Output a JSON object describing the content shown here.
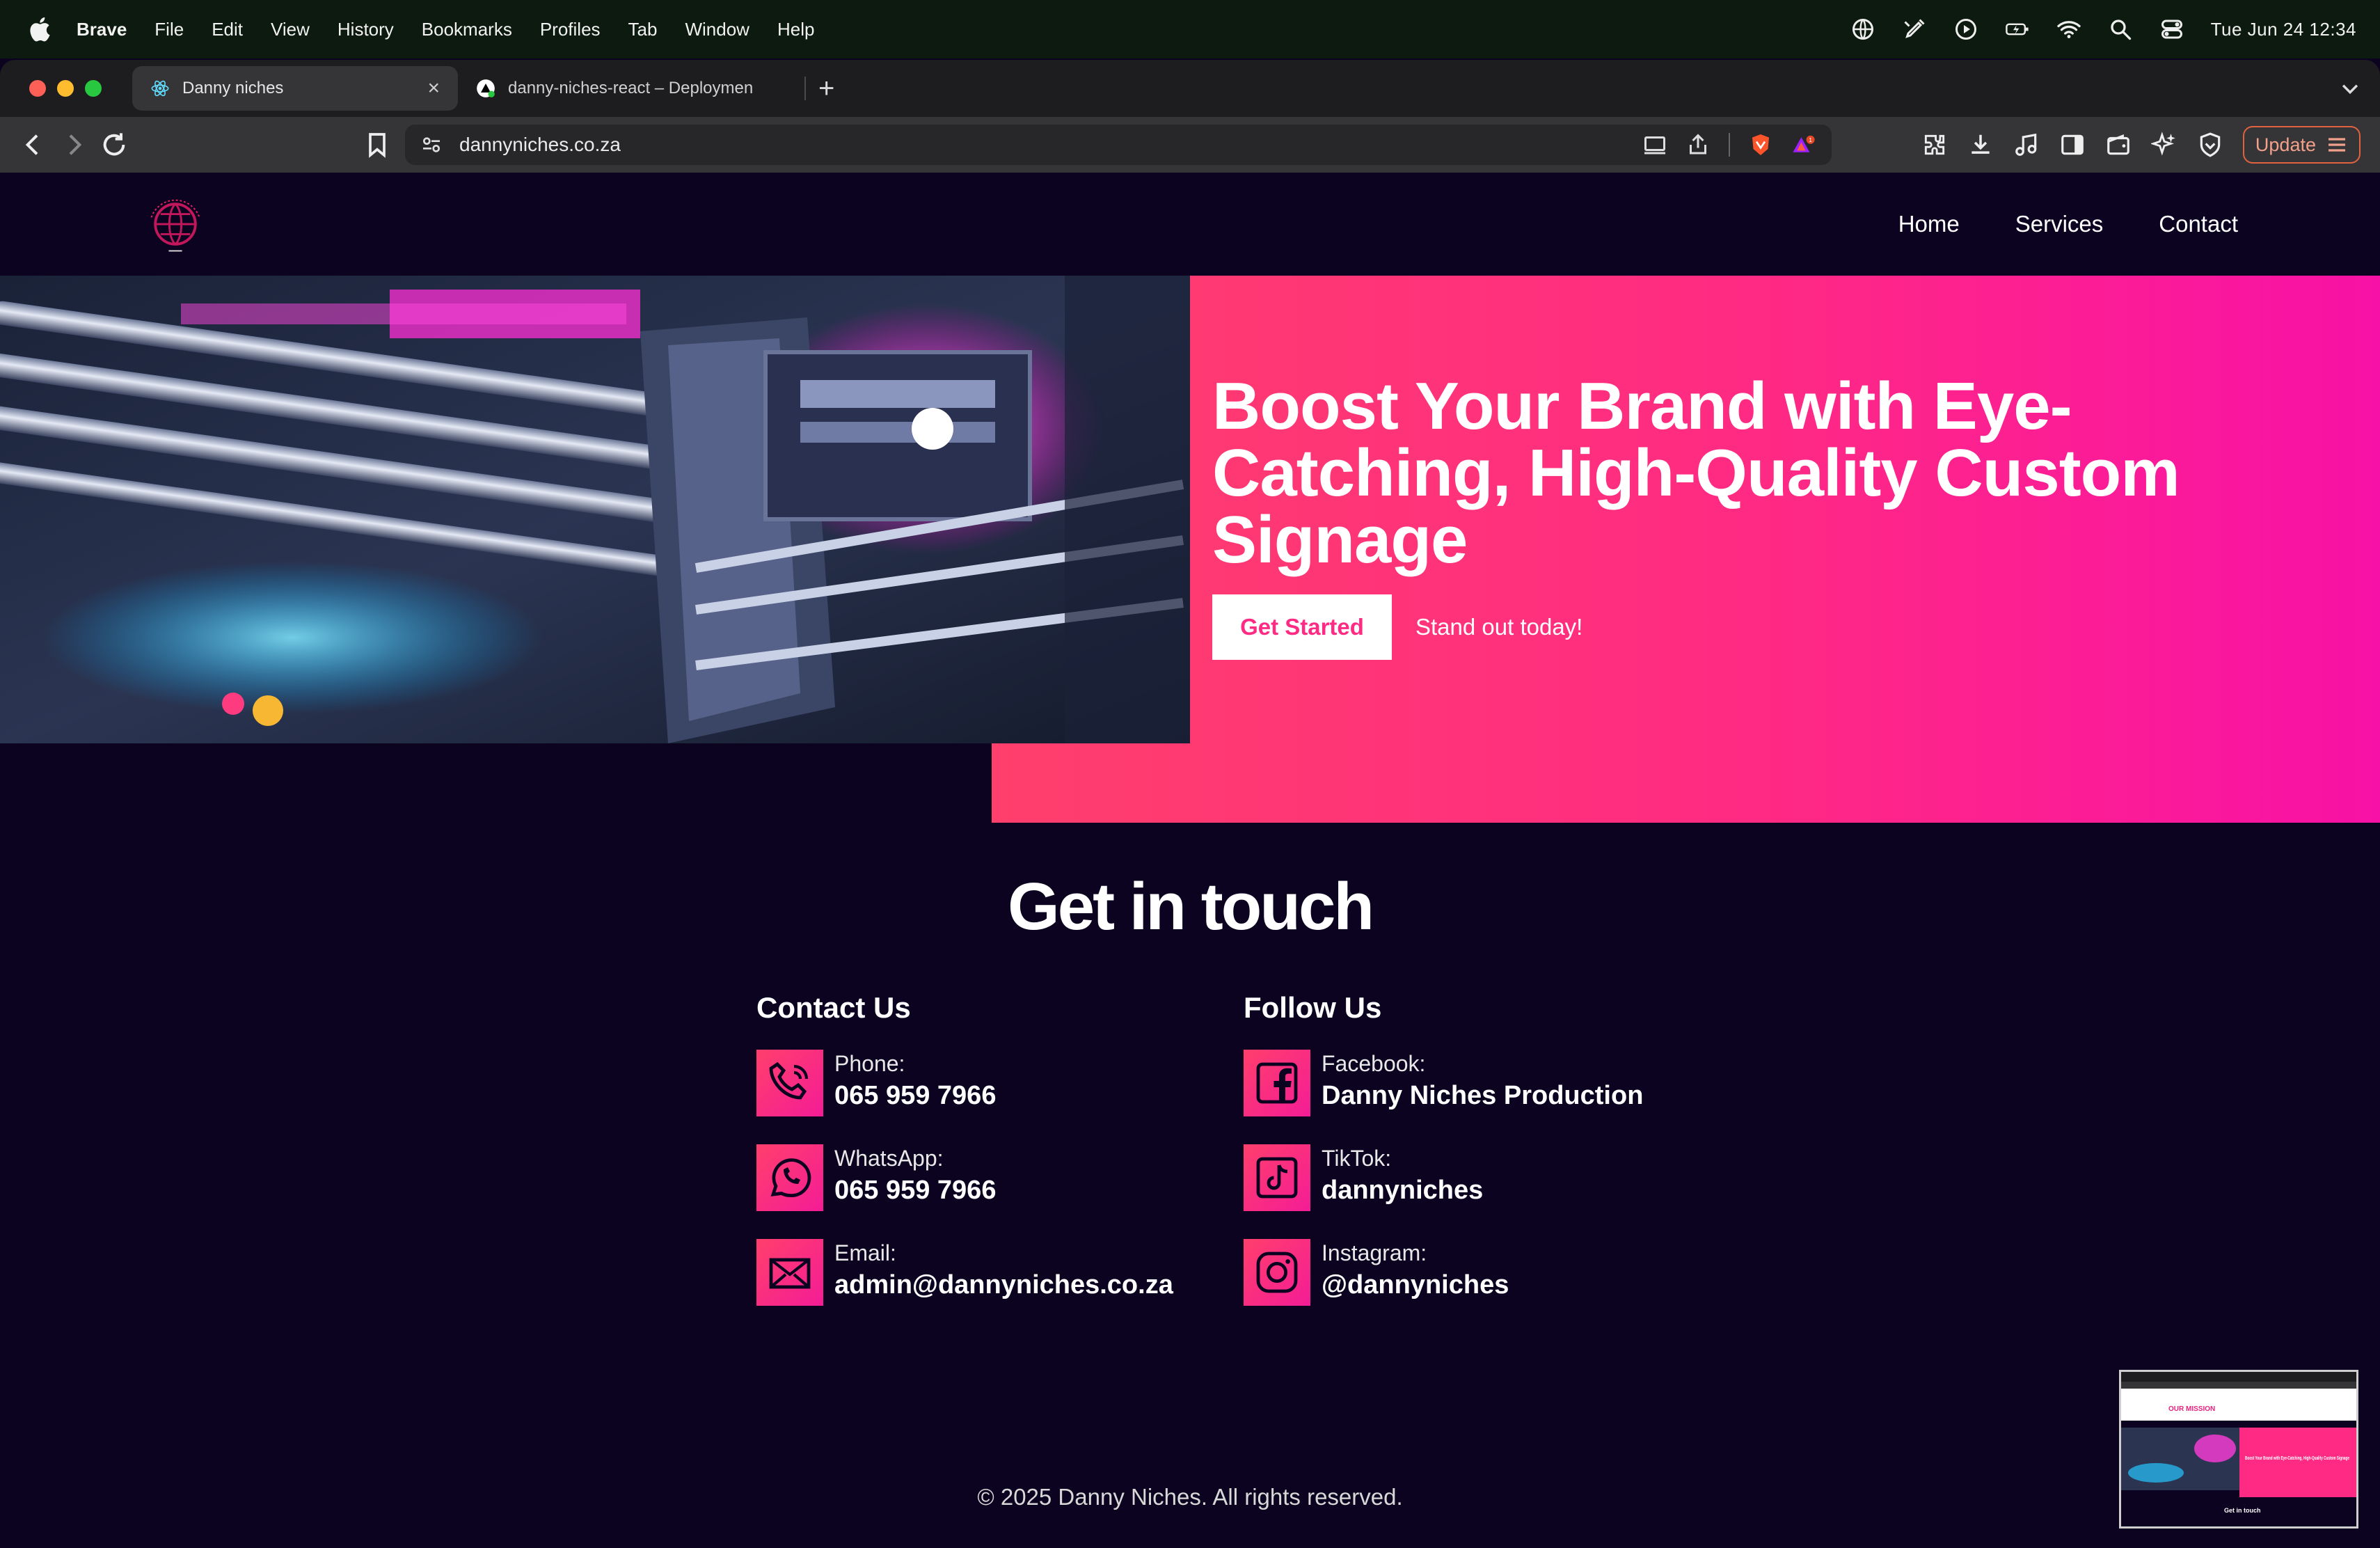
{
  "menubar": {
    "app_name": "Brave",
    "items": [
      "File",
      "Edit",
      "View",
      "History",
      "Bookmarks",
      "Profiles",
      "Tab",
      "Window",
      "Help"
    ],
    "clock": "Tue Jun 24  12:34"
  },
  "browser": {
    "tabs": [
      {
        "title": "Danny niches",
        "active": true
      },
      {
        "title": "danny-niches-react – Deploymen",
        "active": false
      }
    ],
    "new_tab": "+",
    "url": "dannyniches.co.za",
    "update_label": "Update",
    "shield_badge": "1"
  },
  "site": {
    "nav": [
      "Home",
      "Services",
      "Contact"
    ],
    "hero": {
      "title": "Boost Your Brand with Eye-Catching, High-Quality Custom Signage",
      "cta": "Get Started",
      "tagline": "Stand out today!"
    },
    "contact": {
      "title": "Get in touch",
      "contact_us": {
        "heading": "Contact Us",
        "entries": [
          {
            "label": "Phone:",
            "value": "065 959 7966",
            "icon": "phone-icon"
          },
          {
            "label": "WhatsApp:",
            "value": "065 959 7966",
            "icon": "whatsapp-icon"
          },
          {
            "label": "Email:",
            "value": "admin@dannyniches.co.za",
            "icon": "envelope-icon"
          }
        ]
      },
      "follow_us": {
        "heading": "Follow Us",
        "entries": [
          {
            "label": "Facebook:",
            "value": "Danny Niches Production",
            "icon": "facebook-icon"
          },
          {
            "label": "TikTok:",
            "value": "dannyniches",
            "icon": "tiktok-icon"
          },
          {
            "label": "Instagram:",
            "value": "@dannyniches",
            "icon": "instagram-icon"
          }
        ]
      }
    },
    "footer": "© 2025 Danny Niches. All rights reserved.",
    "thumbnail": {
      "mission_label": "OUR MISSION",
      "hero_title": "Boost Your Brand with Eye-Catching, High-Quality Custom Signage",
      "contact_title": "Get in touch"
    }
  },
  "colors": {
    "page_bg": "#0b0320",
    "pink_start": "#ff3f6c",
    "pink_end": "#f811a6",
    "accent": "#ff2a83"
  }
}
